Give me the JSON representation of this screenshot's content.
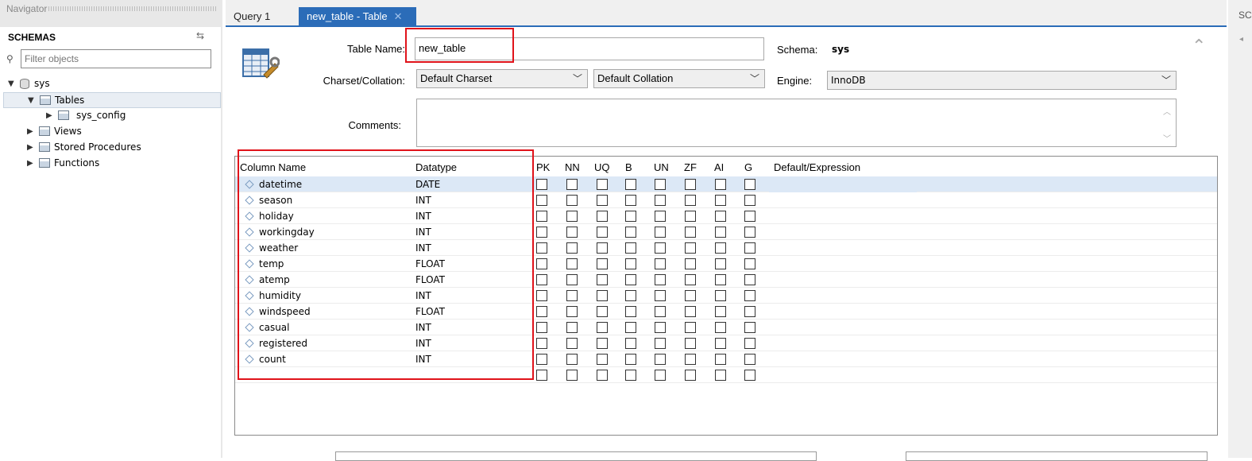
{
  "navigator": {
    "title": "Navigator",
    "schemas_label": "SCHEMAS",
    "filter_placeholder": "Filter objects",
    "tree": {
      "schema": "sys",
      "tables": "Tables",
      "table_item": "sys_config",
      "views": "Views",
      "stored_procedures": "Stored Procedures",
      "functions": "Functions"
    }
  },
  "tabs": [
    {
      "label": "Query 1"
    },
    {
      "label": "new_table - Table"
    }
  ],
  "right_strip_label": "SC",
  "form": {
    "table_name_label": "Table Name:",
    "table_name_value": "new_table",
    "schema_label": "Schema:",
    "schema_value": "sys",
    "charset_label": "Charset/Collation:",
    "charset_value": "Default Charset",
    "collation_value": "Default Collation",
    "engine_label": "Engine:",
    "engine_value": "InnoDB",
    "comments_label": "Comments:"
  },
  "grid": {
    "headers": {
      "column_name": "Column Name",
      "datatype": "Datatype",
      "flags": [
        "PK",
        "NN",
        "UQ",
        "B",
        "UN",
        "ZF",
        "AI",
        "G"
      ],
      "default": "Default/Expression"
    },
    "rows": [
      {
        "name": "datetime",
        "type": "DATE"
      },
      {
        "name": "season",
        "type": "INT"
      },
      {
        "name": "holiday",
        "type": "INT"
      },
      {
        "name": "workingday",
        "type": "INT"
      },
      {
        "name": "weather",
        "type": "INT"
      },
      {
        "name": "temp",
        "type": "FLOAT"
      },
      {
        "name": "atemp",
        "type": "FLOAT"
      },
      {
        "name": "humidity",
        "type": "INT"
      },
      {
        "name": "windspeed",
        "type": "FLOAT"
      },
      {
        "name": "casual",
        "type": "INT"
      },
      {
        "name": "registered",
        "type": "INT"
      },
      {
        "name": "count",
        "type": "INT"
      },
      {
        "name": "",
        "type": ""
      }
    ]
  },
  "colors": {
    "accent": "#2b6cb8",
    "highlight_box": "#e0131a",
    "selection": "#dce8f6"
  }
}
